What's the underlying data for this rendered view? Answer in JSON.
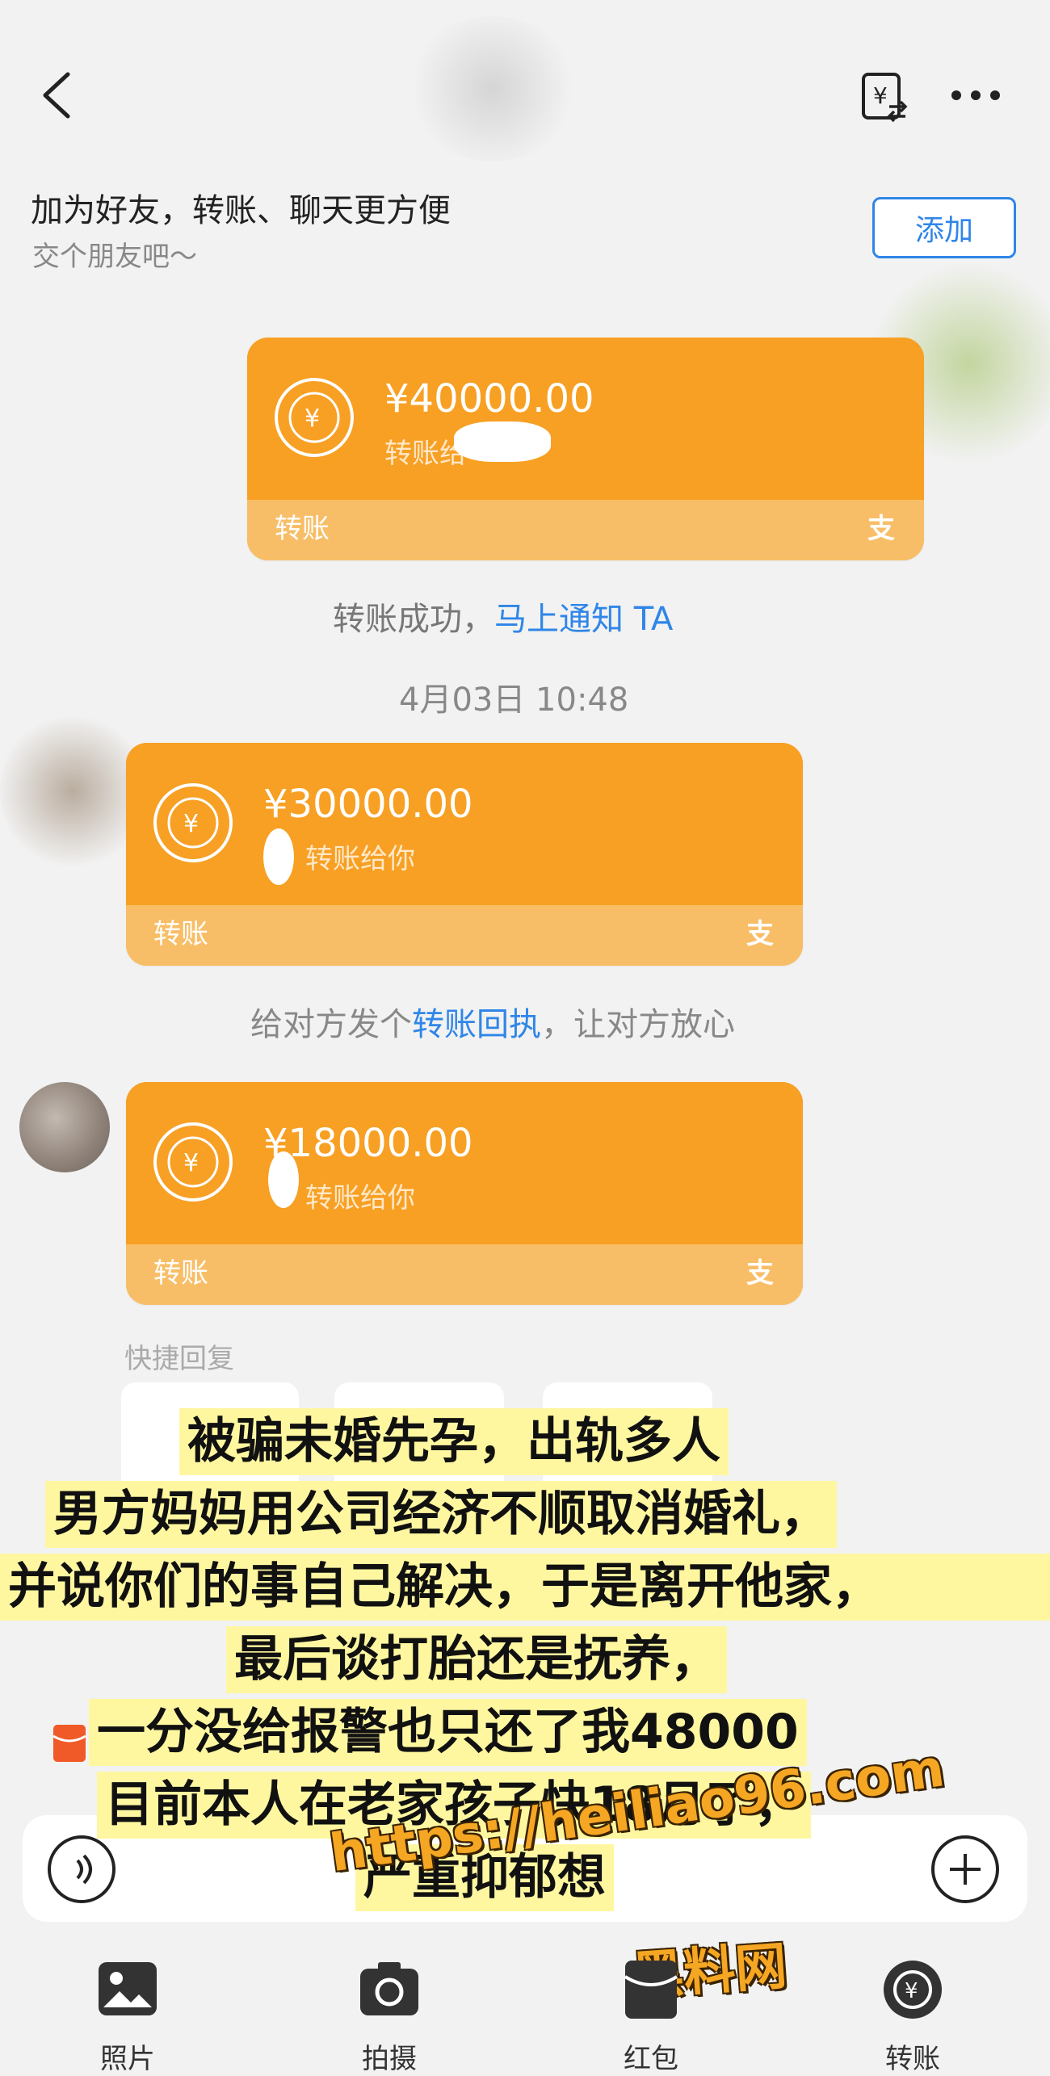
{
  "header": {
    "friend_title": "加为好友，转账、聊天更方便",
    "friend_subtitle": "交个朋友吧～",
    "add_label": "添加"
  },
  "cards": [
    {
      "amount": "¥40000.00",
      "note": "转账给",
      "footer": "转账",
      "brand": "支"
    },
    {
      "amount": "¥30000.00",
      "note": "转账给你",
      "footer": "转账",
      "brand": "支"
    },
    {
      "amount": "¥18000.00",
      "note": "转账给你",
      "footer": "转账",
      "brand": "支"
    }
  ],
  "notices": {
    "success_prefix": "转账成功，",
    "success_link": "马上通知 TA",
    "timestamp": "4月03日 10:48",
    "receipt_prefix": "给对方发个",
    "receipt_link": "转账回执",
    "receipt_suffix": "，让对方放心"
  },
  "quick_reply_label": "快捷回复",
  "caption": [
    "被骗未婚先孕，出轨多人",
    "男方妈妈用公司经济不顺取消婚礼，",
    "并说你们的事自己解决，于是离开他家，",
    "最后谈打胎还是抚养，",
    "一分没给报警也只还了我48000",
    "目前本人在老家孩子快18月了，",
    "严重抑郁想"
  ],
  "watermark": {
    "url": "https://heiliao96.com",
    "name": "黑料网"
  },
  "toolbar": [
    {
      "label": "照片",
      "icon": "photo-icon"
    },
    {
      "label": "拍摄",
      "icon": "camera-icon"
    },
    {
      "label": "红包",
      "icon": "red-packet-icon"
    },
    {
      "label": "转账",
      "icon": "transfer-icon"
    }
  ],
  "colors": {
    "card_orange": "#f7a024",
    "card_footer": "#f8be67",
    "link_blue": "#2f86e8",
    "caption_bg": "#fff7a0",
    "watermark": "#f5a623"
  }
}
